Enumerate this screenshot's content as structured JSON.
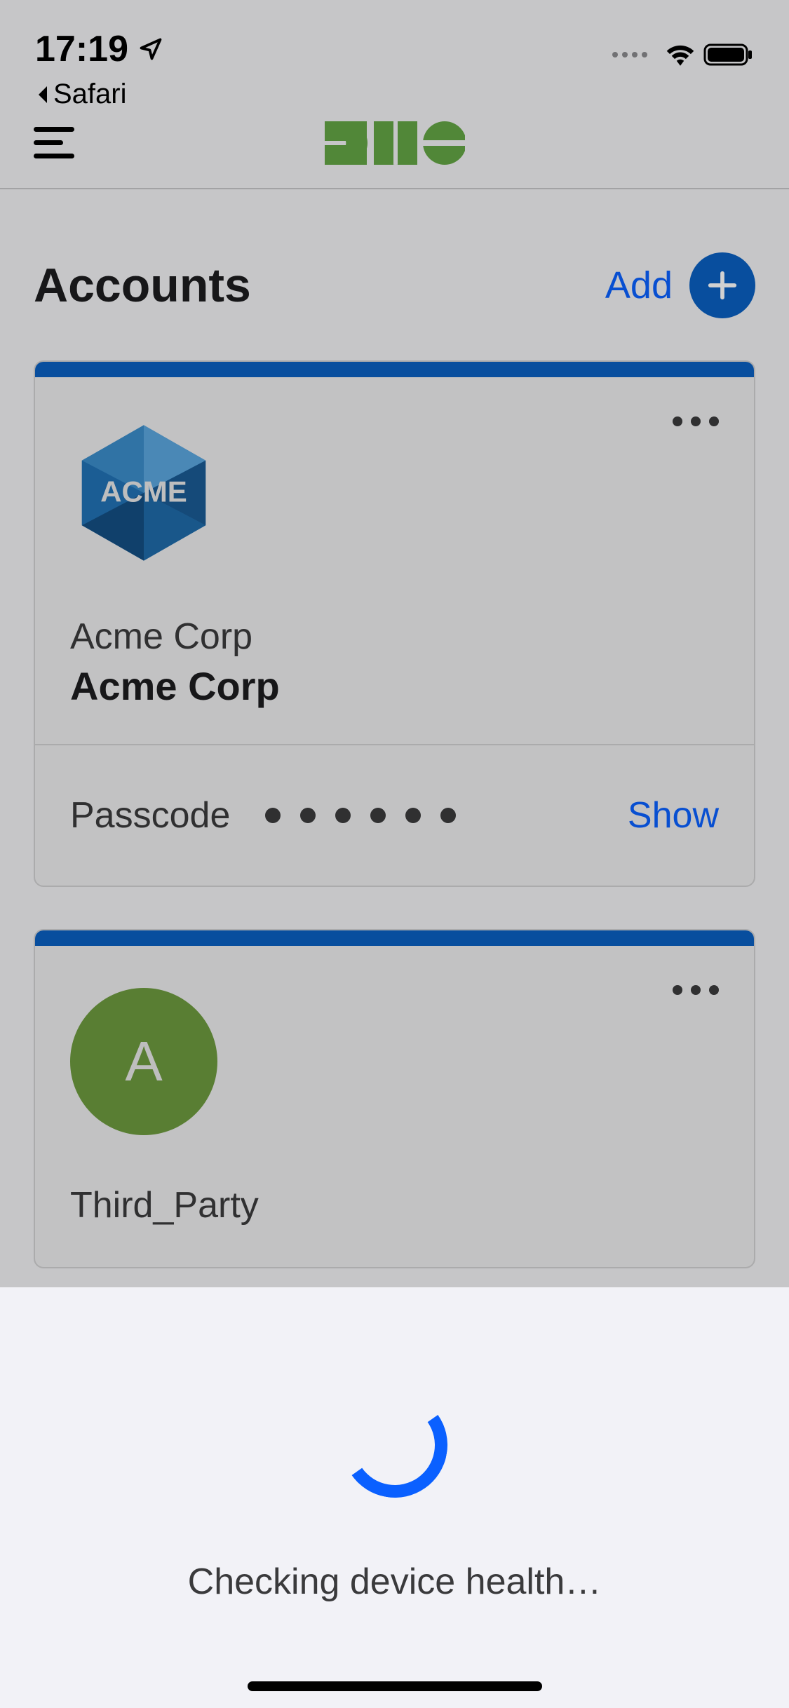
{
  "status_bar": {
    "time": "17:19",
    "back_app": "Safari"
  },
  "header": {
    "section_title": "Accounts",
    "add_label": "Add"
  },
  "accounts": [
    {
      "logo_type": "hex",
      "logo_text": "ACME",
      "org": "Acme Corp",
      "name": "Acme Corp",
      "passcode_label": "Passcode",
      "passcode_masked_length": 6,
      "show_label": "Show"
    },
    {
      "logo_type": "circle",
      "logo_letter": "A",
      "org": "Third_Party"
    }
  ],
  "modal": {
    "message": "Checking device health…"
  },
  "colors": {
    "accent_blue": "#0a60ff",
    "brand_green": "#63a544",
    "stripe_blue": "#0a5fc1"
  }
}
